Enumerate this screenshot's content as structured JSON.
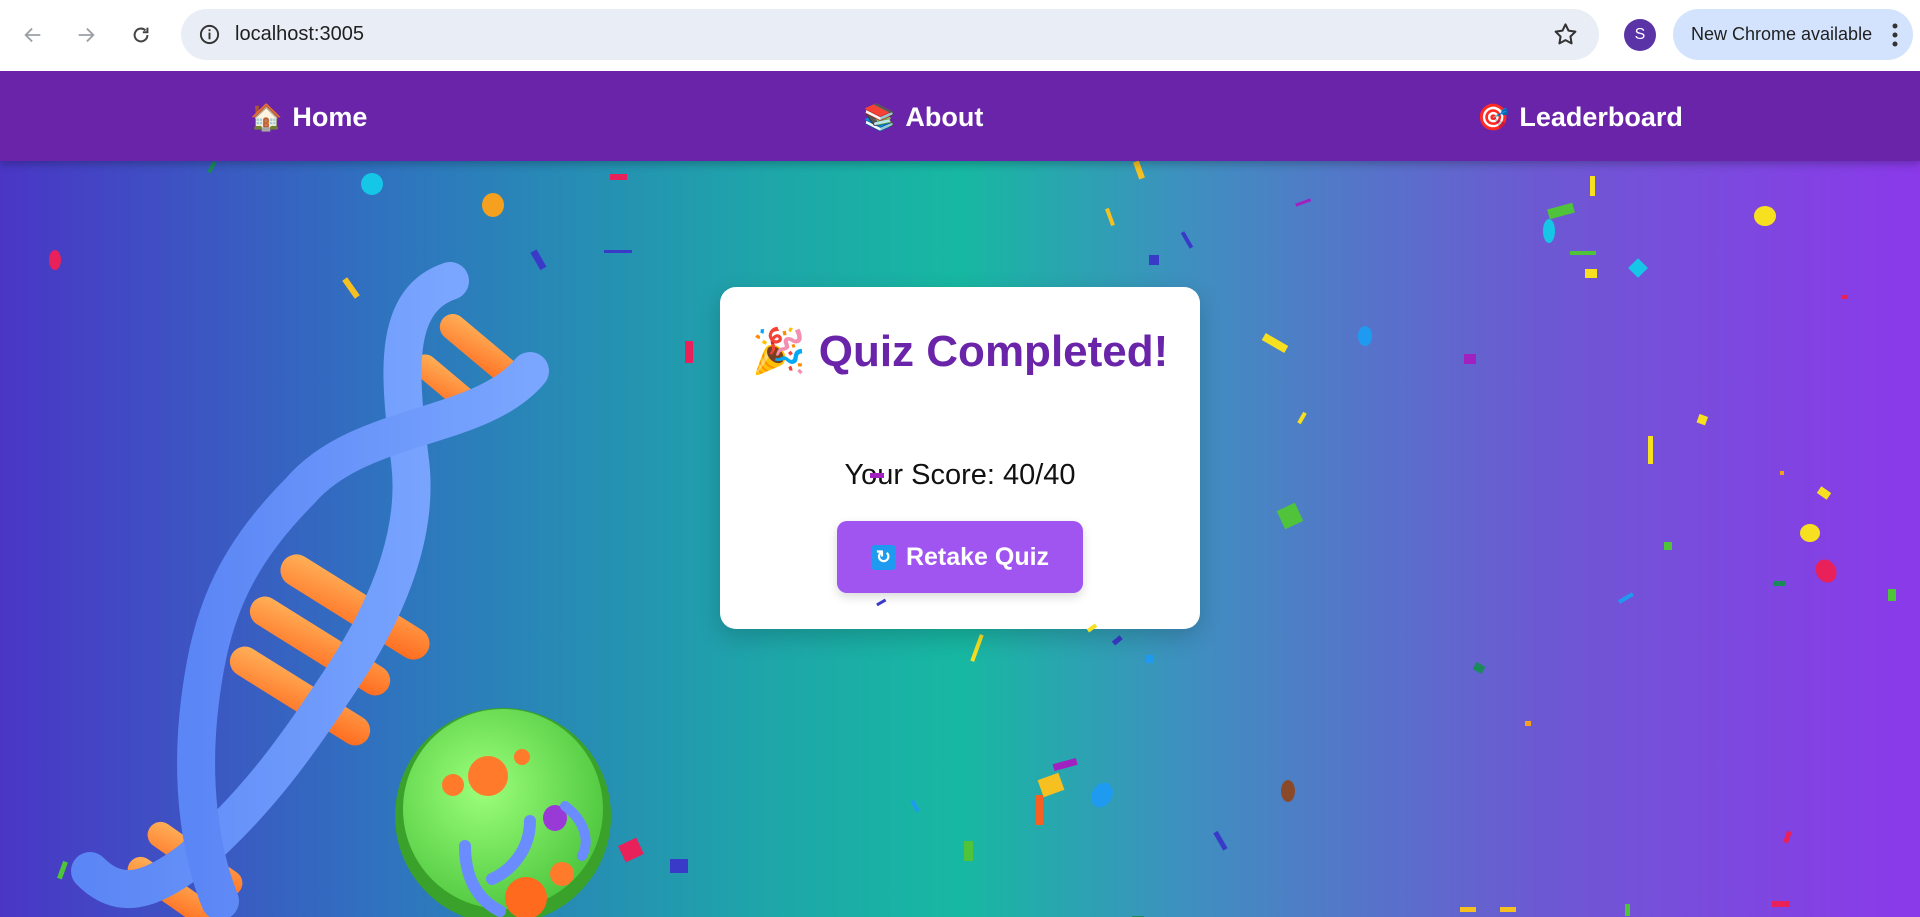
{
  "browser": {
    "url": "localhost:3005",
    "profile_initial": "S",
    "update_label": "New Chrome available",
    "icons": [
      "back-arrow-icon",
      "forward-arrow-icon",
      "reload-icon",
      "site-info-icon",
      "bookmark-star-icon",
      "more-menu-icon"
    ]
  },
  "nav": {
    "items": [
      {
        "emoji": "🏠",
        "label": "Home"
      },
      {
        "emoji": "📚",
        "label": "About"
      },
      {
        "emoji": "🎯",
        "label": "Leaderboard"
      }
    ]
  },
  "result": {
    "title_emoji": "🎉",
    "title": "Quiz Completed!",
    "score_text": "Your Score: 40/40",
    "retake_emoji": "🔄",
    "retake_label": "Retake Quiz"
  },
  "colors": {
    "nav_bg": "#6a24a9",
    "title": "#6a24a9",
    "button_bg": "#a054f0"
  }
}
